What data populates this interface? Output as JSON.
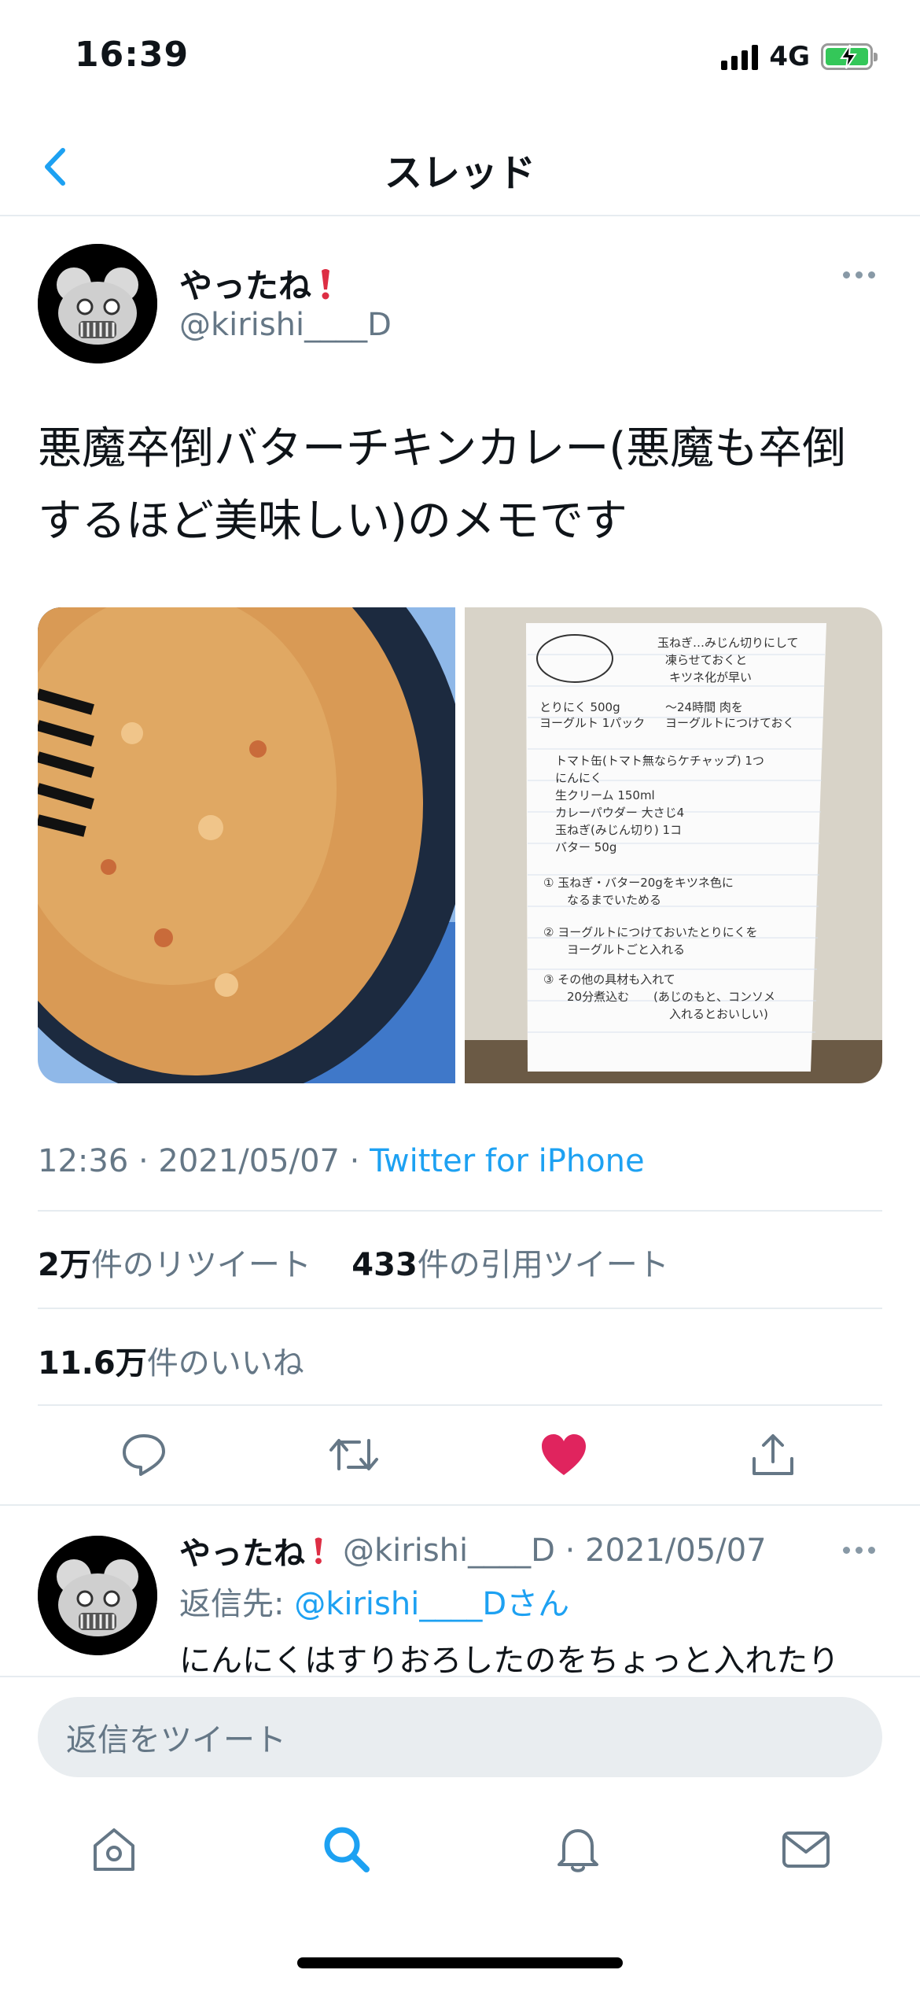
{
  "status_bar": {
    "time": "16:39",
    "network": "4G"
  },
  "nav": {
    "title": "スレッド"
  },
  "tweet": {
    "author_name": "やったね",
    "author_handle": "@kirishi____D",
    "text": "悪魔卒倒バターチキンカレー(悪魔も卒倒するほど美味しい)のメモです",
    "meta_time": "12:36 · 2021/05/07 · ",
    "meta_source": "Twitter for iPhone",
    "retweets_count": "2万",
    "retweets_label": "件のリツイート",
    "quotes_count": "433",
    "quotes_label": "件の引用ツイート",
    "likes_count": "11.6万",
    "likes_label": "件のいいね",
    "liked": true
  },
  "memo": {
    "note1": "玉ねぎ…みじん切りにして",
    "note2": "凍らせておくと",
    "note3": "キツネ化が早い",
    "row1": "とりにく 500g",
    "row2": "ヨーグルト 1パック",
    "row1b": "〜24時間 肉を",
    "row2b": "ヨーグルトにつけておく",
    "ing1": "トマト缶(トマト無ならケチャップ) 1つ",
    "ing2": "にんにく",
    "ing3": "生クリーム 150ml",
    "ing4": "カレーパウダー 大さじ4",
    "ing5": "玉ねぎ(みじん切り) 1コ",
    "ing6": "バター 50g",
    "step1a": "① 玉ねぎ・バター20gをキツネ色に",
    "step1b": "なるまでいためる",
    "step2a": "② ヨーグルトにつけておいたとりにくを",
    "step2b": "ヨーグルトごと入れる",
    "step3a": "③ その他の具材も入れて",
    "step3b": "20分煮込む",
    "step3c": "(あじのもと、コンソメ",
    "step3d": "入れるとおいしい)"
  },
  "reply": {
    "author_name": "やったね",
    "meta": "@kirishi____D · 2021/05/07",
    "reply_to_label": "返信先: ",
    "reply_to_link": "@kirishi____Dさん",
    "text": "にんにくはすりおろしたのをちょっと入れたり"
  },
  "compose": {
    "placeholder": "返信をツイート"
  },
  "colors": {
    "accent": "#1da1f2",
    "like": "#e0245e",
    "text_secondary": "#657786"
  },
  "icons": {
    "back": "chevron-left-icon",
    "reply": "comment-icon",
    "retweet": "retweet-icon",
    "like": "heart-icon",
    "share": "share-icon",
    "home": "home-icon",
    "search": "search-icon",
    "notifications": "bell-icon",
    "messages": "mail-icon"
  }
}
